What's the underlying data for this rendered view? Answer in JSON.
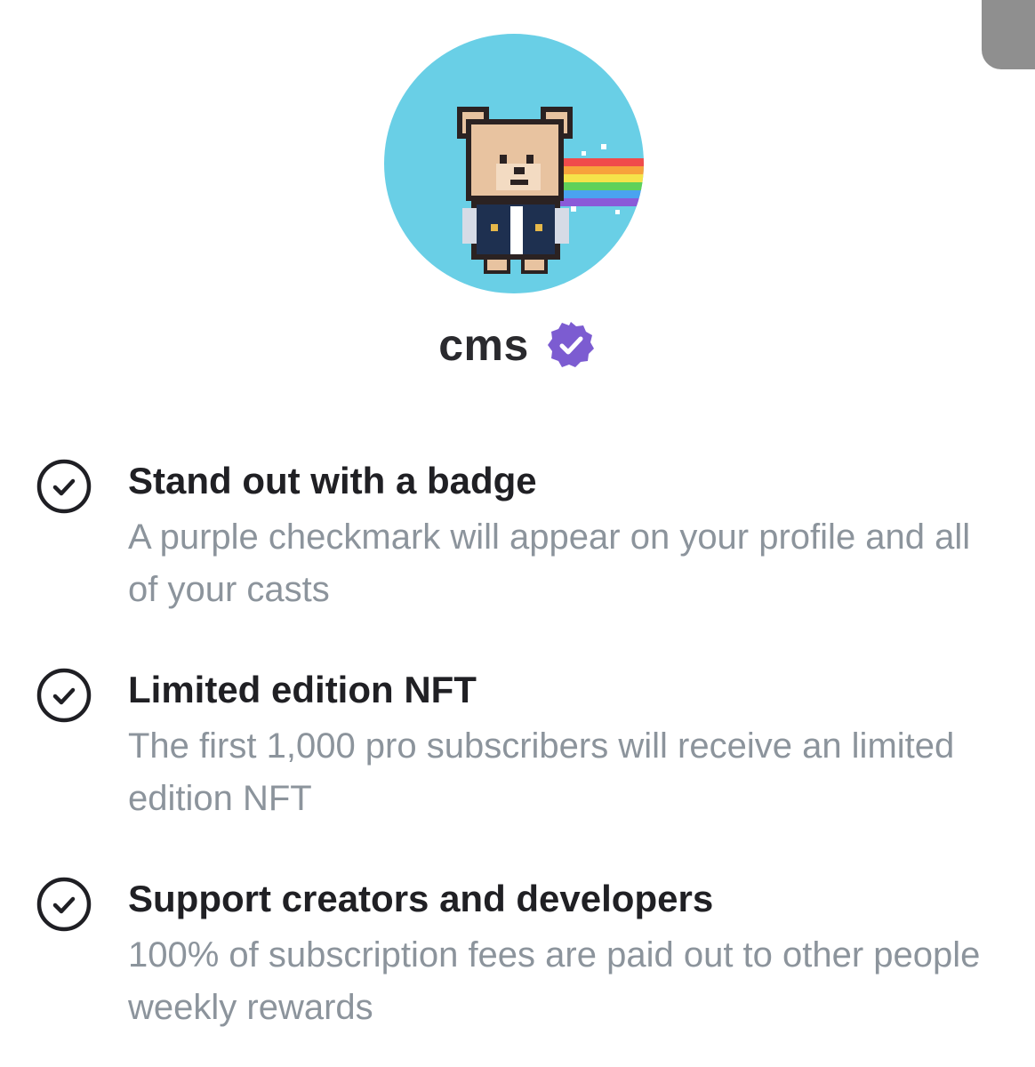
{
  "profile": {
    "username": "cms",
    "avatar_icon": "pixel-bear-rainbow-avatar",
    "verified_icon": "purple-verified-badge-icon",
    "accent_color": "#7c5cd1",
    "avatar_bg_color": "#69cfe6"
  },
  "features": [
    {
      "icon": "circle-check-icon",
      "title": "Stand out with a badge",
      "description": "A purple checkmark will appear on your profile and all of your casts"
    },
    {
      "icon": "circle-check-icon",
      "title": "Limited edition NFT",
      "description": "The first 1,000 pro subscribers will receive an limited edition NFT"
    },
    {
      "icon": "circle-check-icon",
      "title": "Support creators and developers",
      "description": "100% of subscription fees are paid out to other people weekly rewards"
    }
  ]
}
